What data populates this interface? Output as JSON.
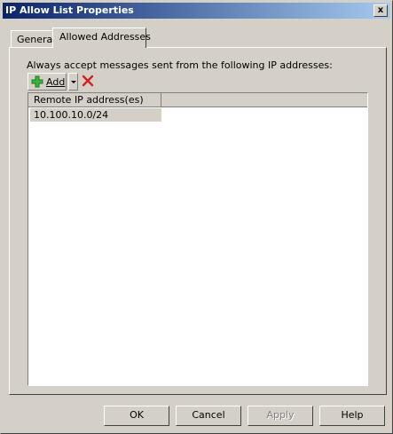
{
  "window": {
    "title": "IP Allow List Properties",
    "close_glyph": "x"
  },
  "tabs": [
    {
      "label": "General",
      "selected": false
    },
    {
      "label": "Allowed Addresses",
      "selected": true
    }
  ],
  "panel": {
    "description": "Always accept messages sent from the following IP addresses:",
    "toolbar": {
      "add_label": "Add",
      "add_icon": "green-plus-icon",
      "dropdown_icon": "chevron-down-icon",
      "delete_icon": "red-x-icon"
    },
    "list": {
      "columns": [
        "Remote IP address(es)"
      ],
      "rows": [
        "10.100.10.0/24"
      ]
    }
  },
  "buttons": {
    "ok": "OK",
    "cancel": "Cancel",
    "apply": "Apply",
    "help": "Help"
  }
}
